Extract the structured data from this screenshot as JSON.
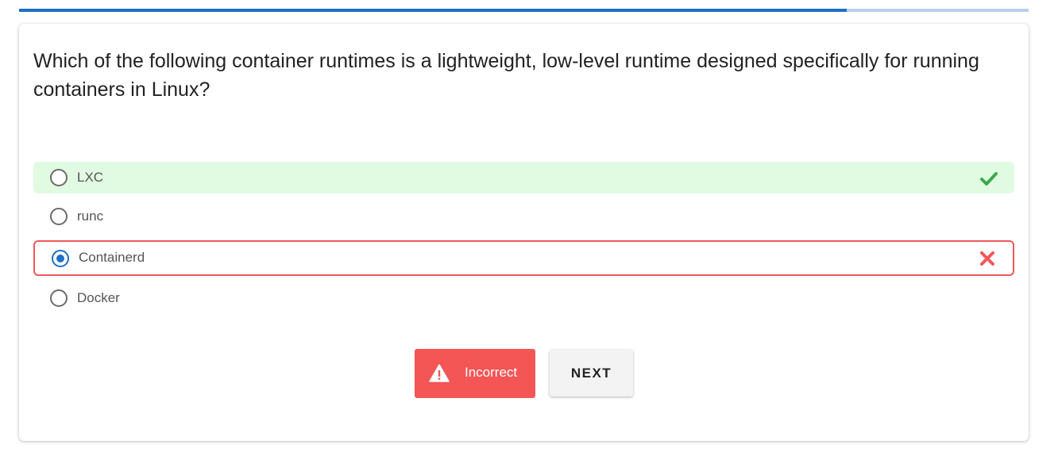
{
  "progress": {
    "fraction": 0.82
  },
  "question": {
    "text": "Which of the following container runtimes is a lightweight, low-level runtime designed specifically for running containers in Linux?"
  },
  "options": [
    {
      "label": "LXC",
      "state": "correct"
    },
    {
      "label": "runc",
      "state": "none"
    },
    {
      "label": "Containerd",
      "state": "selected-wrong"
    },
    {
      "label": "Docker",
      "state": "none"
    }
  ],
  "icons": {
    "correct": "check-icon",
    "wrong": "close-icon",
    "warning": "warning-icon"
  },
  "result_button": {
    "label": "Incorrect"
  },
  "next_button": {
    "label": "NEXT"
  },
  "colors": {
    "accent": "#1f6fc6",
    "correct_bg": "#e1fbe3",
    "correct_icon": "#3daa4b",
    "wrong": "#f05858",
    "incorrect_button": "#f45555"
  }
}
